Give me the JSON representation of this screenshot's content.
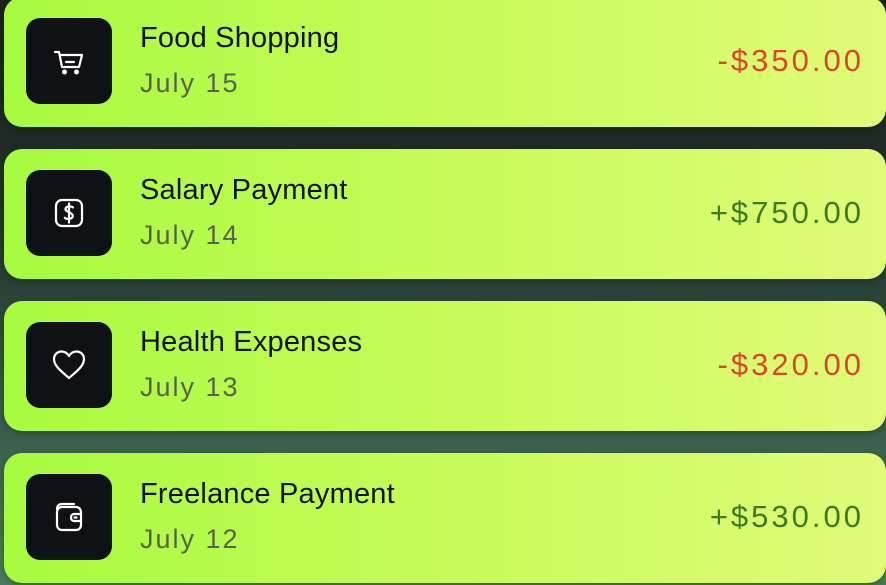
{
  "transactions": [
    {
      "title": "Food Shopping",
      "date": "July 15",
      "amount": "-$350.00",
      "direction": "expense",
      "icon": "shopping-cart-icon",
      "amount_color": "#e0422d"
    },
    {
      "title": "Salary Payment",
      "date": "July 14",
      "amount": "+$750.00",
      "direction": "income",
      "icon": "dollar-icon",
      "amount_color": "#3d7a26"
    },
    {
      "title": "Health Expenses",
      "date": "July 13",
      "amount": "-$320.00",
      "direction": "expense",
      "icon": "heart-icon",
      "amount_color": "#e0422d"
    },
    {
      "title": "Freelance Payment",
      "date": "July 12",
      "amount": "+$530.00",
      "direction": "income",
      "icon": "wallet-icon",
      "amount_color": "#3d7a26"
    }
  ],
  "colors": {
    "card_gradient_start": "#a6fb3f",
    "card_gradient_end": "#e0fb78",
    "icon_tile": "#101114"
  }
}
